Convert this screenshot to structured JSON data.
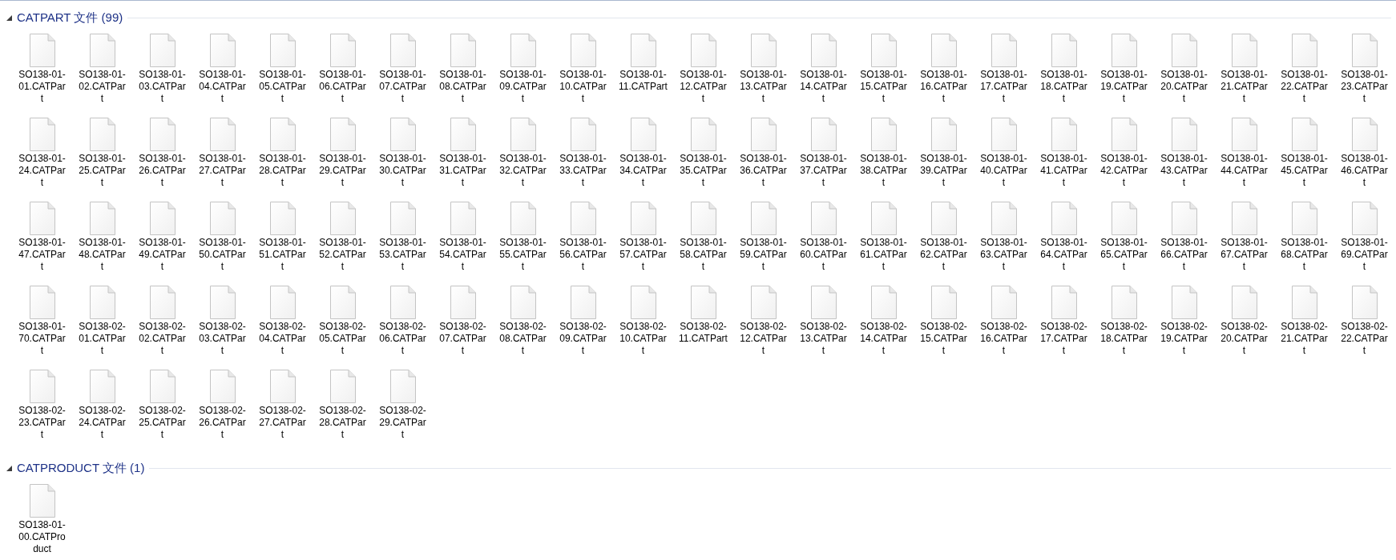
{
  "groups": [
    {
      "title": "CATPART 文件 (99)",
      "expanded": true,
      "files": [
        {
          "name": "SO138-01-01.CATPart"
        },
        {
          "name": "SO138-01-02.CATPart"
        },
        {
          "name": "SO138-01-03.CATPart"
        },
        {
          "name": "SO138-01-04.CATPart"
        },
        {
          "name": "SO138-01-05.CATPart"
        },
        {
          "name": "SO138-01-06.CATPart"
        },
        {
          "name": "SO138-01-07.CATPart"
        },
        {
          "name": "SO138-01-08.CATPart"
        },
        {
          "name": "SO138-01-09.CATPart"
        },
        {
          "name": "SO138-01-10.CATPart"
        },
        {
          "name": "SO138-01-11.CATPart"
        },
        {
          "name": "SO138-01-12.CATPart"
        },
        {
          "name": "SO138-01-13.CATPart"
        },
        {
          "name": "SO138-01-14.CATPart"
        },
        {
          "name": "SO138-01-15.CATPart"
        },
        {
          "name": "SO138-01-16.CATPart"
        },
        {
          "name": "SO138-01-17.CATPart"
        },
        {
          "name": "SO138-01-18.CATPart"
        },
        {
          "name": "SO138-01-19.CATPart"
        },
        {
          "name": "SO138-01-20.CATPart"
        },
        {
          "name": "SO138-01-21.CATPart"
        },
        {
          "name": "SO138-01-22.CATPart"
        },
        {
          "name": "SO138-01-23.CATPart"
        },
        {
          "name": "SO138-01-24.CATPart"
        },
        {
          "name": "SO138-01-25.CATPart"
        },
        {
          "name": "SO138-01-26.CATPart"
        },
        {
          "name": "SO138-01-27.CATPart"
        },
        {
          "name": "SO138-01-28.CATPart"
        },
        {
          "name": "SO138-01-29.CATPart"
        },
        {
          "name": "SO138-01-30.CATPart"
        },
        {
          "name": "SO138-01-31.CATPart"
        },
        {
          "name": "SO138-01-32.CATPart"
        },
        {
          "name": "SO138-01-33.CATPart"
        },
        {
          "name": "SO138-01-34.CATPart"
        },
        {
          "name": "SO138-01-35.CATPart"
        },
        {
          "name": "SO138-01-36.CATPart"
        },
        {
          "name": "SO138-01-37.CATPart"
        },
        {
          "name": "SO138-01-38.CATPart"
        },
        {
          "name": "SO138-01-39.CATPart"
        },
        {
          "name": "SO138-01-40.CATPart"
        },
        {
          "name": "SO138-01-41.CATPart"
        },
        {
          "name": "SO138-01-42.CATPart"
        },
        {
          "name": "SO138-01-43.CATPart"
        },
        {
          "name": "SO138-01-44.CATPart"
        },
        {
          "name": "SO138-01-45.CATPart"
        },
        {
          "name": "SO138-01-46.CATPart"
        },
        {
          "name": "SO138-01-47.CATPart"
        },
        {
          "name": "SO138-01-48.CATPart"
        },
        {
          "name": "SO138-01-49.CATPart"
        },
        {
          "name": "SO138-01-50.CATPart"
        },
        {
          "name": "SO138-01-51.CATPart"
        },
        {
          "name": "SO138-01-52.CATPart"
        },
        {
          "name": "SO138-01-53.CATPart"
        },
        {
          "name": "SO138-01-54.CATPart"
        },
        {
          "name": "SO138-01-55.CATPart"
        },
        {
          "name": "SO138-01-56.CATPart"
        },
        {
          "name": "SO138-01-57.CATPart"
        },
        {
          "name": "SO138-01-58.CATPart"
        },
        {
          "name": "SO138-01-59.CATPart"
        },
        {
          "name": "SO138-01-60.CATPart"
        },
        {
          "name": "SO138-01-61.CATPart"
        },
        {
          "name": "SO138-01-62.CATPart"
        },
        {
          "name": "SO138-01-63.CATPart"
        },
        {
          "name": "SO138-01-64.CATPart"
        },
        {
          "name": "SO138-01-65.CATPart"
        },
        {
          "name": "SO138-01-66.CATPart"
        },
        {
          "name": "SO138-01-67.CATPart"
        },
        {
          "name": "SO138-01-68.CATPart"
        },
        {
          "name": "SO138-01-69.CATPart"
        },
        {
          "name": "SO138-01-70.CATPart"
        },
        {
          "name": "SO138-02-01.CATPart"
        },
        {
          "name": "SO138-02-02.CATPart"
        },
        {
          "name": "SO138-02-03.CATPart"
        },
        {
          "name": "SO138-02-04.CATPart"
        },
        {
          "name": "SO138-02-05.CATPart"
        },
        {
          "name": "SO138-02-06.CATPart"
        },
        {
          "name": "SO138-02-07.CATPart"
        },
        {
          "name": "SO138-02-08.CATPart"
        },
        {
          "name": "SO138-02-09.CATPart"
        },
        {
          "name": "SO138-02-10.CATPart"
        },
        {
          "name": "SO138-02-11.CATPart"
        },
        {
          "name": "SO138-02-12.CATPart"
        },
        {
          "name": "SO138-02-13.CATPart"
        },
        {
          "name": "SO138-02-14.CATPart"
        },
        {
          "name": "SO138-02-15.CATPart"
        },
        {
          "name": "SO138-02-16.CATPart"
        },
        {
          "name": "SO138-02-17.CATPart"
        },
        {
          "name": "SO138-02-18.CATPart"
        },
        {
          "name": "SO138-02-19.CATPart"
        },
        {
          "name": "SO138-02-20.CATPart"
        },
        {
          "name": "SO138-02-21.CATPart"
        },
        {
          "name": "SO138-02-22.CATPart"
        },
        {
          "name": "SO138-02-23.CATPart"
        },
        {
          "name": "SO138-02-24.CATPart"
        },
        {
          "name": "SO138-02-25.CATPart"
        },
        {
          "name": "SO138-02-26.CATPart"
        },
        {
          "name": "SO138-02-27.CATPart"
        },
        {
          "name": "SO138-02-28.CATPart"
        },
        {
          "name": "SO138-02-29.CATPart"
        }
      ]
    },
    {
      "title": "CATPRODUCT 文件 (1)",
      "expanded": true,
      "files": [
        {
          "name": "SO138-01-00.CATProduct"
        }
      ]
    }
  ]
}
